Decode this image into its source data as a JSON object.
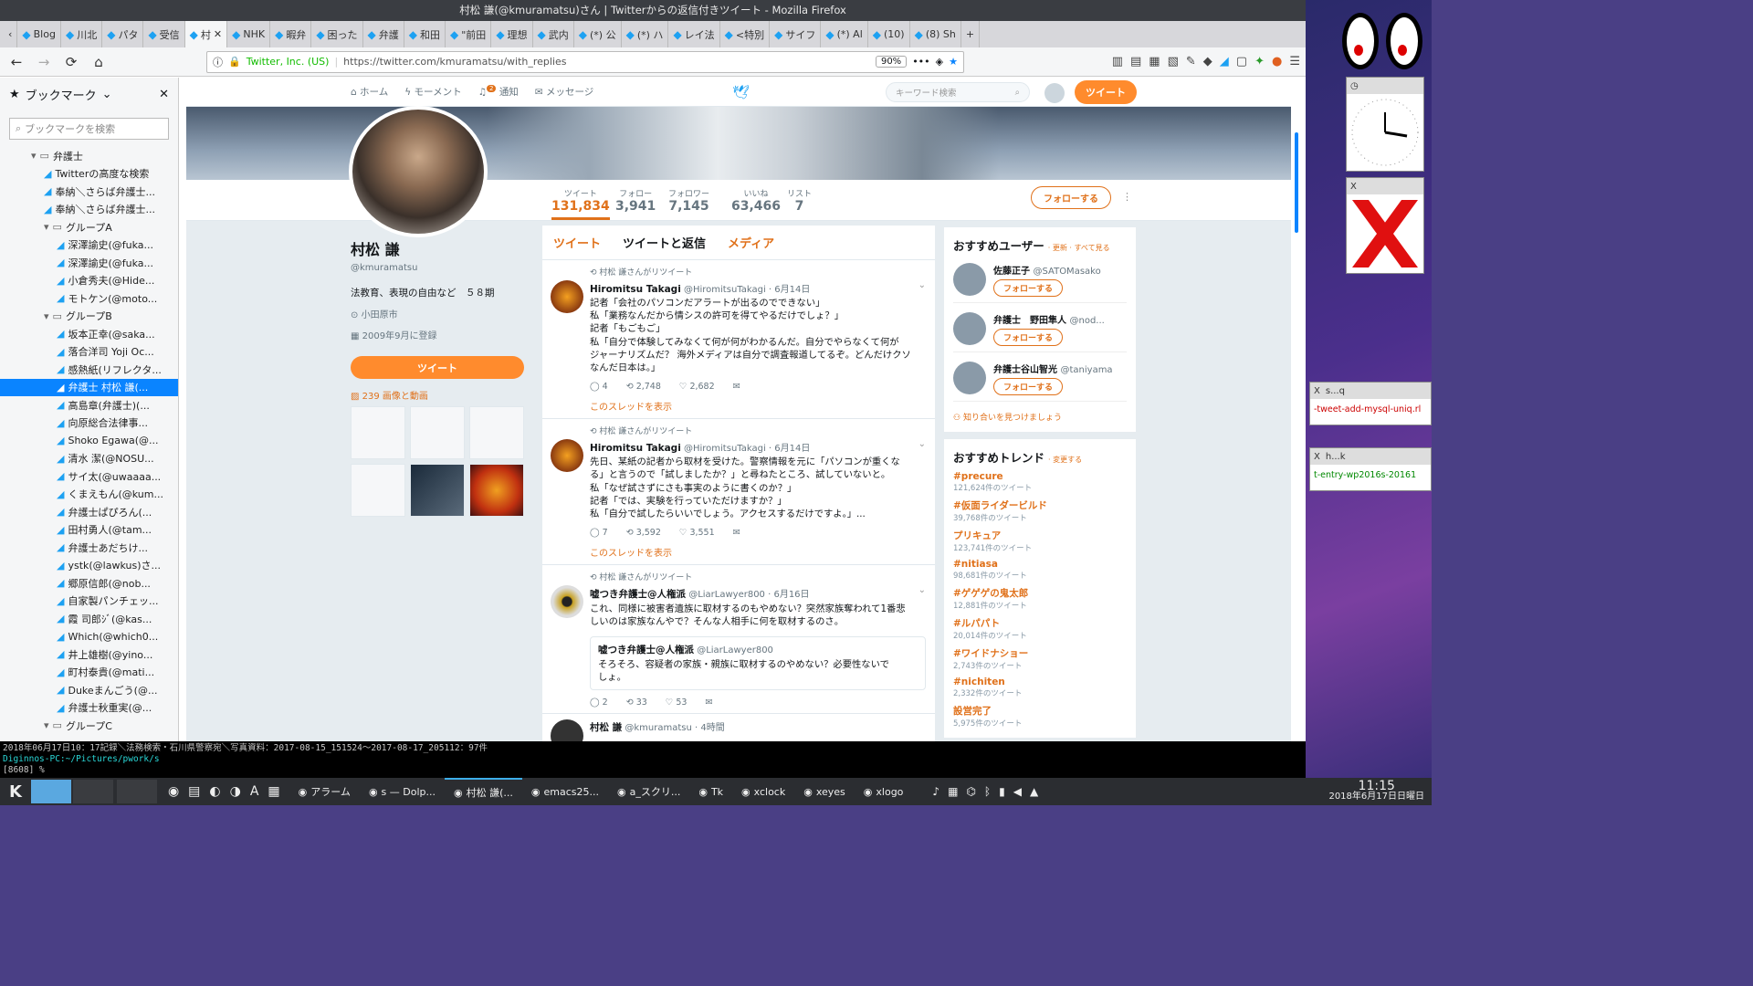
{
  "window": {
    "title": "村松 謙(@kmuramatsu)さん | Twitterからの返信付きツイート - Mozilla Firefox"
  },
  "tabs": [
    "Blog",
    "川北",
    "パタ",
    "受信",
    "村",
    "NHK",
    "暇弁",
    "困った",
    "弁護",
    "和田",
    "\"前田",
    "理想",
    "武内",
    "(*) 公",
    "(*) ハ",
    "レイ法",
    "<特別",
    "サイフ",
    "(*) Al",
    "(10)",
    "(8) Sh"
  ],
  "nav": {
    "identity": "Twitter, Inc. (US)",
    "url": "https://twitter.com/kmuramatsu/with_replies",
    "zoom": "90%"
  },
  "sidebar": {
    "title": "ブックマーク",
    "search_placeholder": "ブックマークを検索",
    "items": [
      {
        "type": "folder",
        "label": "弁護士",
        "indent": 1
      },
      {
        "type": "tw",
        "label": "Twitterの高度な検索",
        "indent": 2
      },
      {
        "type": "tw",
        "label": "奉納＼さらば弁護士...",
        "indent": 2
      },
      {
        "type": "tw",
        "label": "奉納＼さらば弁護士...",
        "indent": 2
      },
      {
        "type": "folder",
        "label": "グループA",
        "indent": 2
      },
      {
        "type": "tw",
        "label": "深澤諭史(@fuka...",
        "indent": 3
      },
      {
        "type": "tw",
        "label": "深澤諭史(@fuka...",
        "indent": 3
      },
      {
        "type": "tw",
        "label": "小倉秀夫(@Hide...",
        "indent": 3
      },
      {
        "type": "tw",
        "label": "モトケン(@moto...",
        "indent": 3
      },
      {
        "type": "folder",
        "label": "グループB",
        "indent": 2
      },
      {
        "type": "tw",
        "label": "坂本正幸(@saka...",
        "indent": 3
      },
      {
        "type": "tw",
        "label": "落合洋司 Yoji Oc...",
        "indent": 3
      },
      {
        "type": "tw",
        "label": "感熱紙(リフレクタ...",
        "indent": 3
      },
      {
        "type": "tw",
        "label": "弁護士 村松 謙(...",
        "indent": 3,
        "selected": true
      },
      {
        "type": "tw",
        "label": "高島章(弁護士)(...",
        "indent": 3
      },
      {
        "type": "tw",
        "label": "向原総合法律事...",
        "indent": 3
      },
      {
        "type": "tw",
        "label": "Shoko Egawa(@...",
        "indent": 3
      },
      {
        "type": "tw",
        "label": "清水 潔(@NOSU...",
        "indent": 3
      },
      {
        "type": "tw",
        "label": "サイ太(@uwaaaa...",
        "indent": 3
      },
      {
        "type": "tw",
        "label": "くまえもん(@kum...",
        "indent": 3
      },
      {
        "type": "tw",
        "label": "弁護士ぱぴろん(...",
        "indent": 3
      },
      {
        "type": "tw",
        "label": "田村勇人(@tam...",
        "indent": 3
      },
      {
        "type": "tw",
        "label": "弁護士あだちけ...",
        "indent": 3
      },
      {
        "type": "tw",
        "label": "ystk(@lawkus)さ...",
        "indent": 3
      },
      {
        "type": "tw",
        "label": "郷原信郎(@nob...",
        "indent": 3
      },
      {
        "type": "tw",
        "label": "自家製パンチェッ...",
        "indent": 3
      },
      {
        "type": "tw",
        "label": "霞 司郎ｼﾞ(@kas...",
        "indent": 3
      },
      {
        "type": "tw",
        "label": "Which(@which0...",
        "indent": 3
      },
      {
        "type": "tw",
        "label": "井上雄樹(@yino...",
        "indent": 3
      },
      {
        "type": "tw",
        "label": "町村泰貴(@mati...",
        "indent": 3
      },
      {
        "type": "tw",
        "label": "Dukeまんごう(@...",
        "indent": 3
      },
      {
        "type": "tw",
        "label": "弁護士秋重実(@...",
        "indent": 3
      },
      {
        "type": "folder",
        "label": "グループC",
        "indent": 2
      }
    ]
  },
  "twitter": {
    "nav": {
      "home": "ホーム",
      "moments": "モーメント",
      "notif": "通知",
      "notif_badge": "2",
      "messages": "メッセージ",
      "search_placeholder": "キーワード検索",
      "tweet_btn": "ツイート"
    },
    "stats": [
      {
        "label": "ツイート",
        "value": "131,834"
      },
      {
        "label": "フォロー",
        "value": "3,941"
      },
      {
        "label": "フォロワー",
        "value": "7,145"
      },
      {
        "label": "いいね",
        "value": "63,466"
      },
      {
        "label": "リスト",
        "value": "7"
      }
    ],
    "follow_btn": "フォローする",
    "profile": {
      "name": "村松 謙",
      "handle": "@kmuramatsu",
      "bio": "法教育、表現の自由など　５８期",
      "location": "小田原市",
      "joined": "2009年9月に登録",
      "tweet_btn": "ツイート",
      "media": "239 画像と動画"
    },
    "tl_tabs": [
      "ツイート",
      "ツイートと返信",
      "メディア"
    ],
    "tweets": [
      {
        "rt": "村松 謙さんがリツイート",
        "name": "Hiromitsu Takagi",
        "meta": "@HiromitsuTakagi · 6月14日",
        "lines": [
          "記者「会社のパソコンだアラートが出るのでできない」",
          "私「業務なんだから情シスの許可を得てやるだけでしょ？」",
          "記者「もごもご」",
          "私「自分で体験してみなくて何が何がわかるんだ。自分でやらなくて何が",
          "ジャーナリズムだ？ 海外メディアは自分で調査報道してるぞ。どんだけクソ",
          "なんだ日本は。」"
        ],
        "reply": "4",
        "rts": "2,748",
        "likes": "2,682",
        "thread": "このスレッドを表示"
      },
      {
        "rt": "村松 謙さんがリツイート",
        "name": "Hiromitsu Takagi",
        "meta": "@HiromitsuTakagi · 6月14日",
        "lines": [
          "先日、某紙の記者から取材を受けた。警察情報を元に「パソコンが重くな",
          "る」と言うので「試しましたか？」と尋ねたところ、試していないと。",
          "私「なぜ試さずにさも事実のように書くのか？」",
          "記者「では、実験を行っていただけますか？」",
          "私「自分で試したらいいでしょう。アクセスするだけですよ。」..."
        ],
        "reply": "7",
        "rts": "3,592",
        "likes": "3,551",
        "thread": "このスレッドを表示"
      },
      {
        "rt": "村松 謙さんがリツイート",
        "name": "嘘つき弁護士@人権派",
        "meta": "@LiarLawyer800 · 6月16日",
        "lines": [
          "これ、同様に被害者遺族に取材するのもやめない？突然家族奪われて1番悲",
          "しいのは家族なんやで？そんな人相手に何を取材するのさ。"
        ],
        "quote_name": "嘘つき弁護士@人権派",
        "quote_meta": "@LiarLawyer800",
        "quote_lines": [
          "そろそろ、容疑者の家族・親族に取材するのやめない？必要性ないで",
          "しょ。"
        ],
        "reply": "2",
        "rts": "33",
        "likes": "53"
      }
    ],
    "last_tweet": {
      "name": "村松 謙",
      "meta": "@kmuramatsu · 4時間"
    },
    "suggest": {
      "title": "おすすめユーザー",
      "links": "· 更新 · すべて見る",
      "users": [
        {
          "name": "佐藤正子",
          "handle": "@SATOMasako"
        },
        {
          "name": "弁護士　野田隼人",
          "handle": "@nod..."
        },
        {
          "name": "弁護士谷山智光",
          "handle": "@taniyama"
        }
      ],
      "follow": "フォローする",
      "find": "知り合いを見つけましょう"
    },
    "trends": {
      "title": "おすすめトレンド",
      "change": "· 変更する",
      "items": [
        {
          "tag": "#precure",
          "count": "121,624件のツイート"
        },
        {
          "tag": "#仮面ライダービルド",
          "count": "39,768件のツイート"
        },
        {
          "tag": "プリキュア",
          "count": "123,741件のツイート"
        },
        {
          "tag": "#nitiasa",
          "count": "98,681件のツイート"
        },
        {
          "tag": "#ゲゲゲの鬼太郎",
          "count": "12,881件のツイート"
        },
        {
          "tag": "#ルパパト",
          "count": "20,014件のツイート"
        },
        {
          "tag": "#ワイドナショー",
          "count": "2,743件のツイート"
        },
        {
          "tag": "#nichiten",
          "count": "2,332件のツイート"
        },
        {
          "tag": "設営完了",
          "count": "5,975件のツイート"
        }
      ]
    }
  },
  "terminal": {
    "line1": "2018年06月17日10：17記録＼法務検索・石川県警察宛＼写真資料：2017-08-15_151524〜2017-08-17_205112：97件",
    "prompt_host": "Diginnos-PC:~/Pictures/pwork/s",
    "line3": "[8608]  % "
  },
  "desktop": {
    "win1": "s...q",
    "win1_text": "-tweet-add-mysql-uniq.rl",
    "win2": "h...k",
    "win2_text": "t-entry-wp2016s-20161"
  },
  "taskbar": {
    "items": [
      "アラーム",
      "s — Dolp...",
      "村松 謙(...",
      "emacs25...",
      "a_スクリ...",
      "Tk",
      "xclock",
      "xeyes",
      "xlogo"
    ],
    "time": "11:15",
    "date": "2018年6月17日日曜日"
  }
}
